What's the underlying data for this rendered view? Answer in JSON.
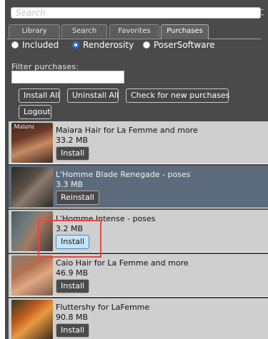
{
  "search": {
    "placeholder": "Search"
  },
  "tabs": [
    {
      "label": "Library"
    },
    {
      "label": "Search"
    },
    {
      "label": "Favorites"
    },
    {
      "label": "Purchases",
      "active": true
    }
  ],
  "sources": {
    "options": [
      {
        "label": "Included",
        "selected": false
      },
      {
        "label": "Renderosity",
        "selected": true
      },
      {
        "label": "PoserSoftware",
        "selected": false
      }
    ]
  },
  "filter": {
    "label": "Filter purchases:",
    "value": ""
  },
  "actions": {
    "install_all": "Install All",
    "uninstall_all": "Uninstall All",
    "check_new": "Check for new purchases",
    "logout": "Logout"
  },
  "items": [
    {
      "title": "Maiara Hair for La Femme and more",
      "size": "33.2 MB",
      "button": "Install",
      "thumb_text": "Maiara"
    },
    {
      "title": "L'Homme Blade Renegade - poses",
      "size": "3.3 MB",
      "button": "Reinstall"
    },
    {
      "title": "L'Homme Intense - poses",
      "size": "3.2 MB",
      "button": "Install"
    },
    {
      "title": "Caio Hair for La Femme and more",
      "size": "46.9 MB",
      "button": "Install"
    },
    {
      "title": "Fluttershy for LaFemme",
      "size": "90.8 MB",
      "button": "Install"
    }
  ],
  "colors": {
    "panel_bg": "#4a4a4a",
    "row_bg": "#cfcfcf",
    "row_highlight_bg": "#5c6b7b",
    "radio_selected": "#2a6fd0",
    "focus_button_bg": "#c9e3f6",
    "callout_border": "#e24949"
  }
}
